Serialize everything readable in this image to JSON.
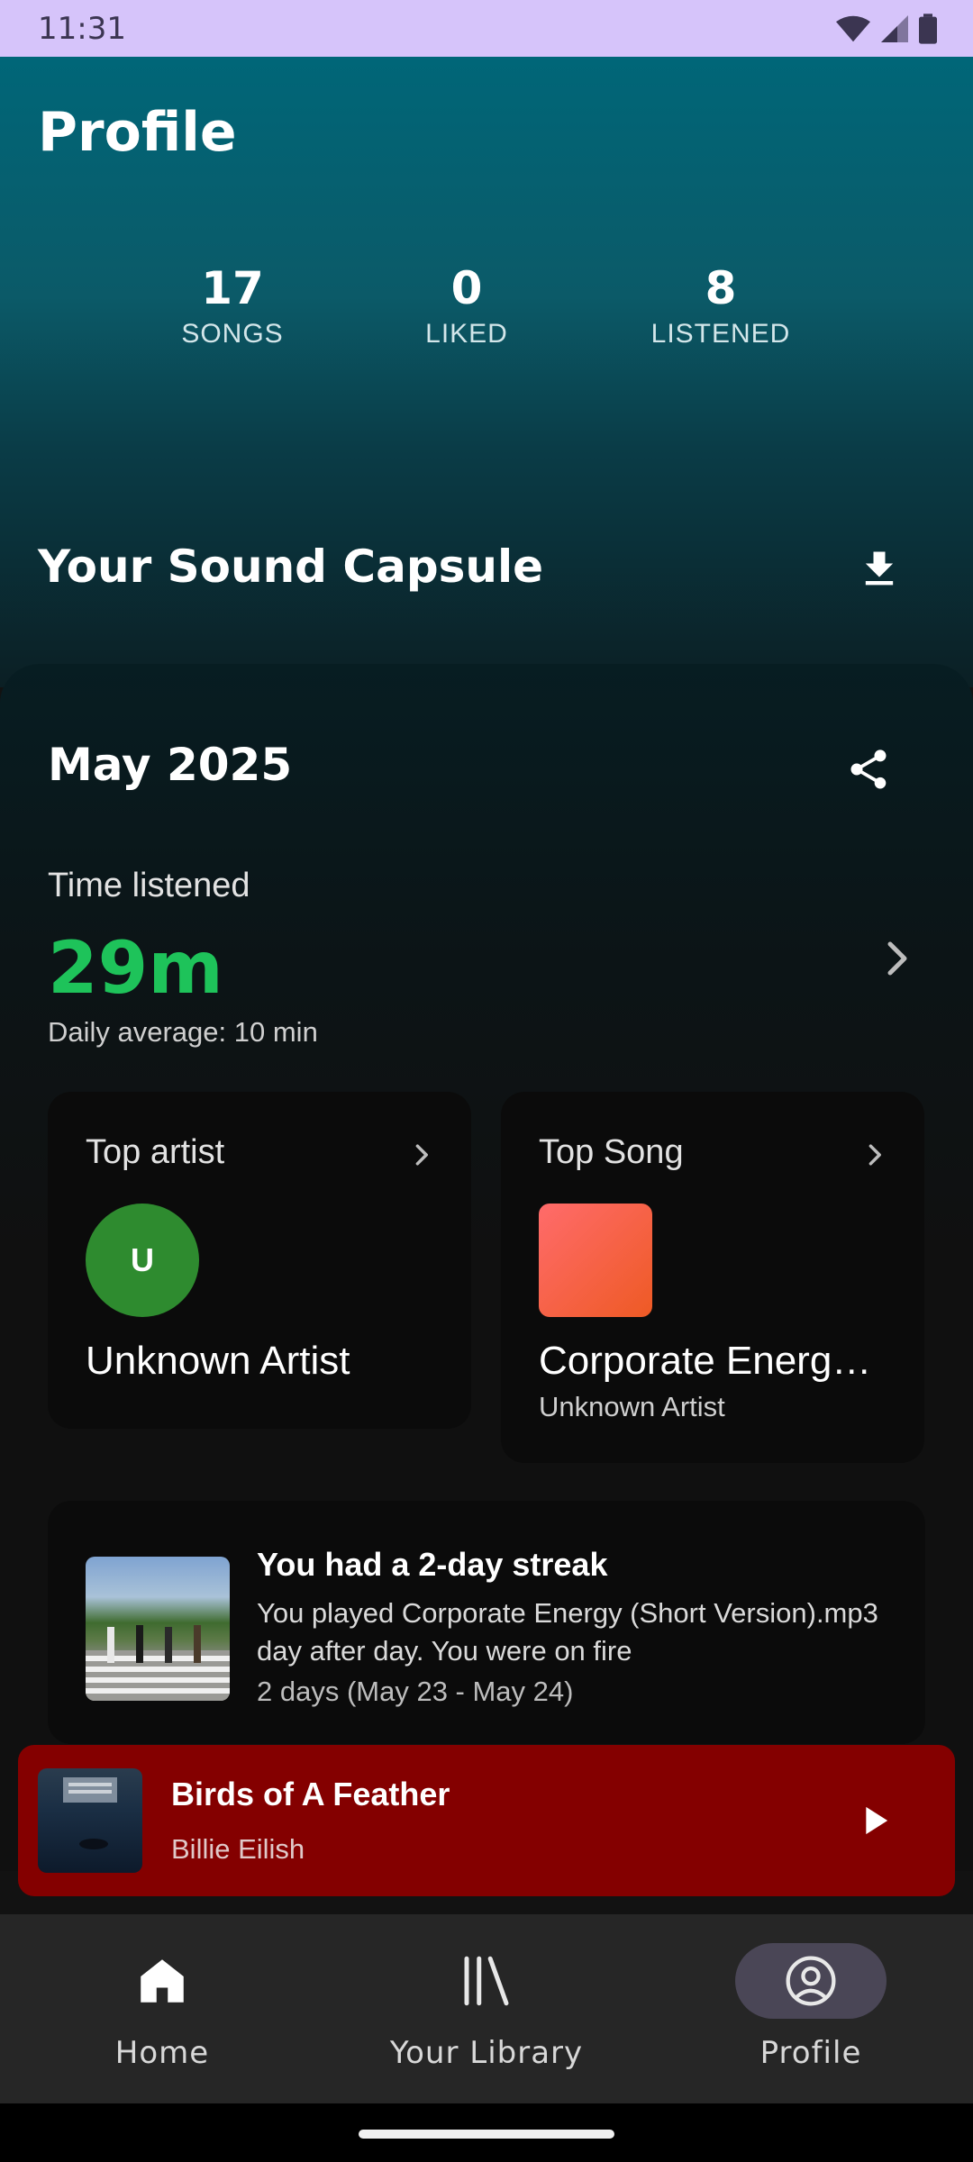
{
  "status_bar": {
    "time": "11:31"
  },
  "header": {
    "title": "Profile"
  },
  "stats": [
    {
      "value": "17",
      "label": "SONGS"
    },
    {
      "value": "0",
      "label": "LIKED"
    },
    {
      "value": "8",
      "label": "LISTENED"
    }
  ],
  "sound_capsule": {
    "title": "Your Sound Capsule",
    "month": "May 2025",
    "time_listened_label": "Time listened",
    "time_listened_value": "29m",
    "daily_average": "Daily average: 10 min",
    "accent_color": "#1ec35a",
    "top_artist": {
      "label": "Top artist",
      "avatar_letter": "U",
      "name": "Unknown Artist"
    },
    "top_song": {
      "label": "Top Song",
      "title": "Corporate Energ…",
      "artist": "Unknown Artist"
    },
    "streak": {
      "title": "You had a 2-day streak",
      "description": "You played Corporate Energy (Short Version).mp3 day after day. You were on fire",
      "dates": "2 days (May 23 - May 24)"
    }
  },
  "now_playing": {
    "title": "Birds of A Feather",
    "artist": "Billie Eilish",
    "background": "#840000"
  },
  "bottom_nav": {
    "items": [
      {
        "label": "Home",
        "icon": "home-icon",
        "active": false
      },
      {
        "label": "Your Library",
        "icon": "library-icon",
        "active": false
      },
      {
        "label": "Profile",
        "icon": "profile-icon",
        "active": true
      }
    ]
  }
}
